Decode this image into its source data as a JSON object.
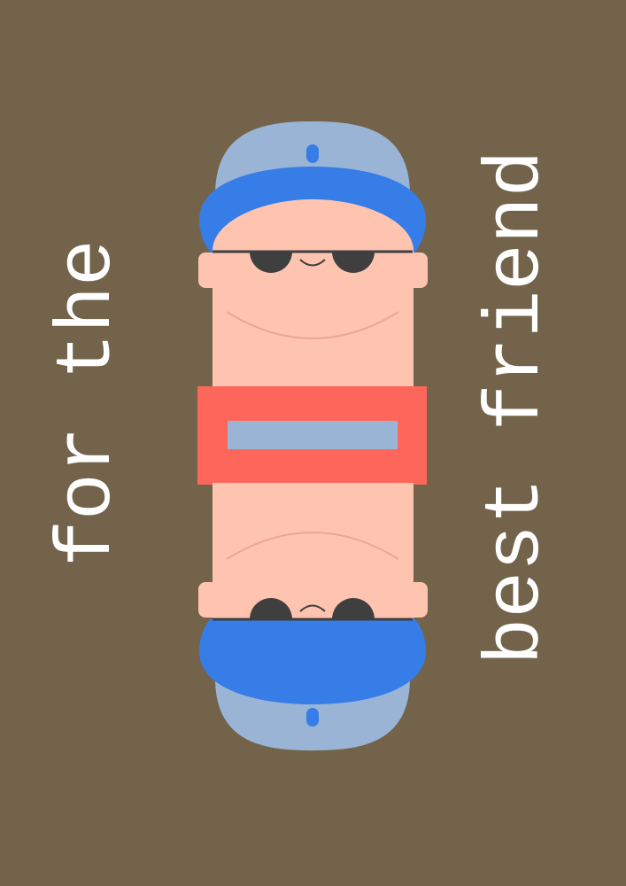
{
  "card": {
    "text_left": "for the",
    "text_right": "best friend"
  },
  "colors": {
    "background": "#73634a",
    "text": "#ffffff",
    "hat_crown": "#9ab4d6",
    "hat_brim": "#377de7",
    "hat_button": "#377de7",
    "skin": "#ffc4b0",
    "skin_line": "#eaa892",
    "glasses": "#3f3f3f",
    "shirt": "#fd675b",
    "shirt_stripe": "#9ab4d6"
  },
  "icons": [
    "best-friend-character-illustration",
    "sunglasses-icon",
    "baseball-cap-icon"
  ]
}
